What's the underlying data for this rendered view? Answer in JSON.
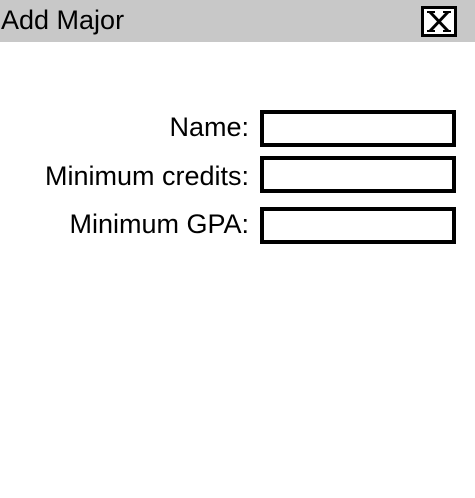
{
  "window": {
    "title": "Add Major",
    "close_icon": "close-x-icon"
  },
  "form": {
    "name": {
      "label": "Name:",
      "value": "",
      "placeholder": ""
    },
    "min_credits": {
      "label": "Minimum credits:",
      "value": "",
      "placeholder": ""
    },
    "min_gpa": {
      "label": "Minimum GPA:",
      "value": "",
      "placeholder": ""
    }
  },
  "colors": {
    "titlebar": "#c8c8c8",
    "background": "#ffffff",
    "border": "#000000"
  }
}
